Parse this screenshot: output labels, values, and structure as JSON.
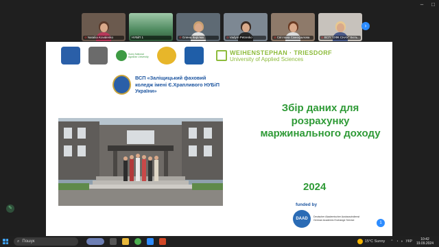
{
  "window_controls": [
    "–",
    "□"
  ],
  "participants": [
    {
      "name": "Nataliia Kovalenko",
      "muted": true,
      "hair": "#5a3a2a",
      "shirt": "#b7395a",
      "bg": "#6b5a4e"
    },
    {
      "name": "НУБіП 1",
      "muted": false,
      "hair": "",
      "shirt": "",
      "bg": "#3f7a5a"
    },
    {
      "name": "Олена Кирілюк",
      "muted": true,
      "hair": "#c9a070",
      "shirt": "#e0e0e0",
      "bg": "#5e6a74"
    },
    {
      "name": "Vadym Petrenko",
      "muted": true,
      "hair": "#3b2a22",
      "shirt": "#2a2a2a",
      "bg": "#7d8893"
    },
    {
      "name": "Світлана Самофалова",
      "muted": true,
      "hair": "#6a3a22",
      "shirt": "#dcdcdc",
      "bg": "#8e7a6a"
    },
    {
      "name": "ВСП \"ОФК СНАУ\" Бєль...",
      "muted": true,
      "hair": "#e8c890",
      "shirt": "#4a5a8a",
      "bg": "#c7c2bc"
    }
  ],
  "slide": {
    "logos": [
      {
        "name": "coat-of-arms-logo",
        "color": "#2a5fa8",
        "round": false
      },
      {
        "name": "ministry-logo",
        "color": "#6b6b6b",
        "round": false
      },
      {
        "name": "sumy-nau-logo",
        "color": "#3e9b44",
        "round": true
      },
      {
        "name": "university-seal-logo",
        "color": "#e7b62a",
        "round": true
      },
      {
        "name": "shield-logo",
        "color": "#1f5ea8",
        "round": false
      }
    ],
    "sumy_logo_text": "Sumy National Agrarian University",
    "weihenstephan": {
      "line1": "WEIHENSTEPHAN · TRIESDORF",
      "line2": "University of Applied Sciences"
    },
    "college_name": "ВСП «Заліщицький фаховий коледж імені Є.Храпливого НУБіП України»",
    "title": "Збір даних для розрахунку маржинального доходу",
    "year": "2024",
    "funded_by": "funded by",
    "daad_short": "DAAD",
    "daad_text": "Deutscher Akademischer Austauschdienst German Academic Exchange Service",
    "page_number": "1"
  },
  "taskbar": {
    "search_placeholder": "Пошук",
    "weather": "15°C  Sunny",
    "lang": "УКР",
    "time": "10:42",
    "date": "19.09.2024"
  }
}
